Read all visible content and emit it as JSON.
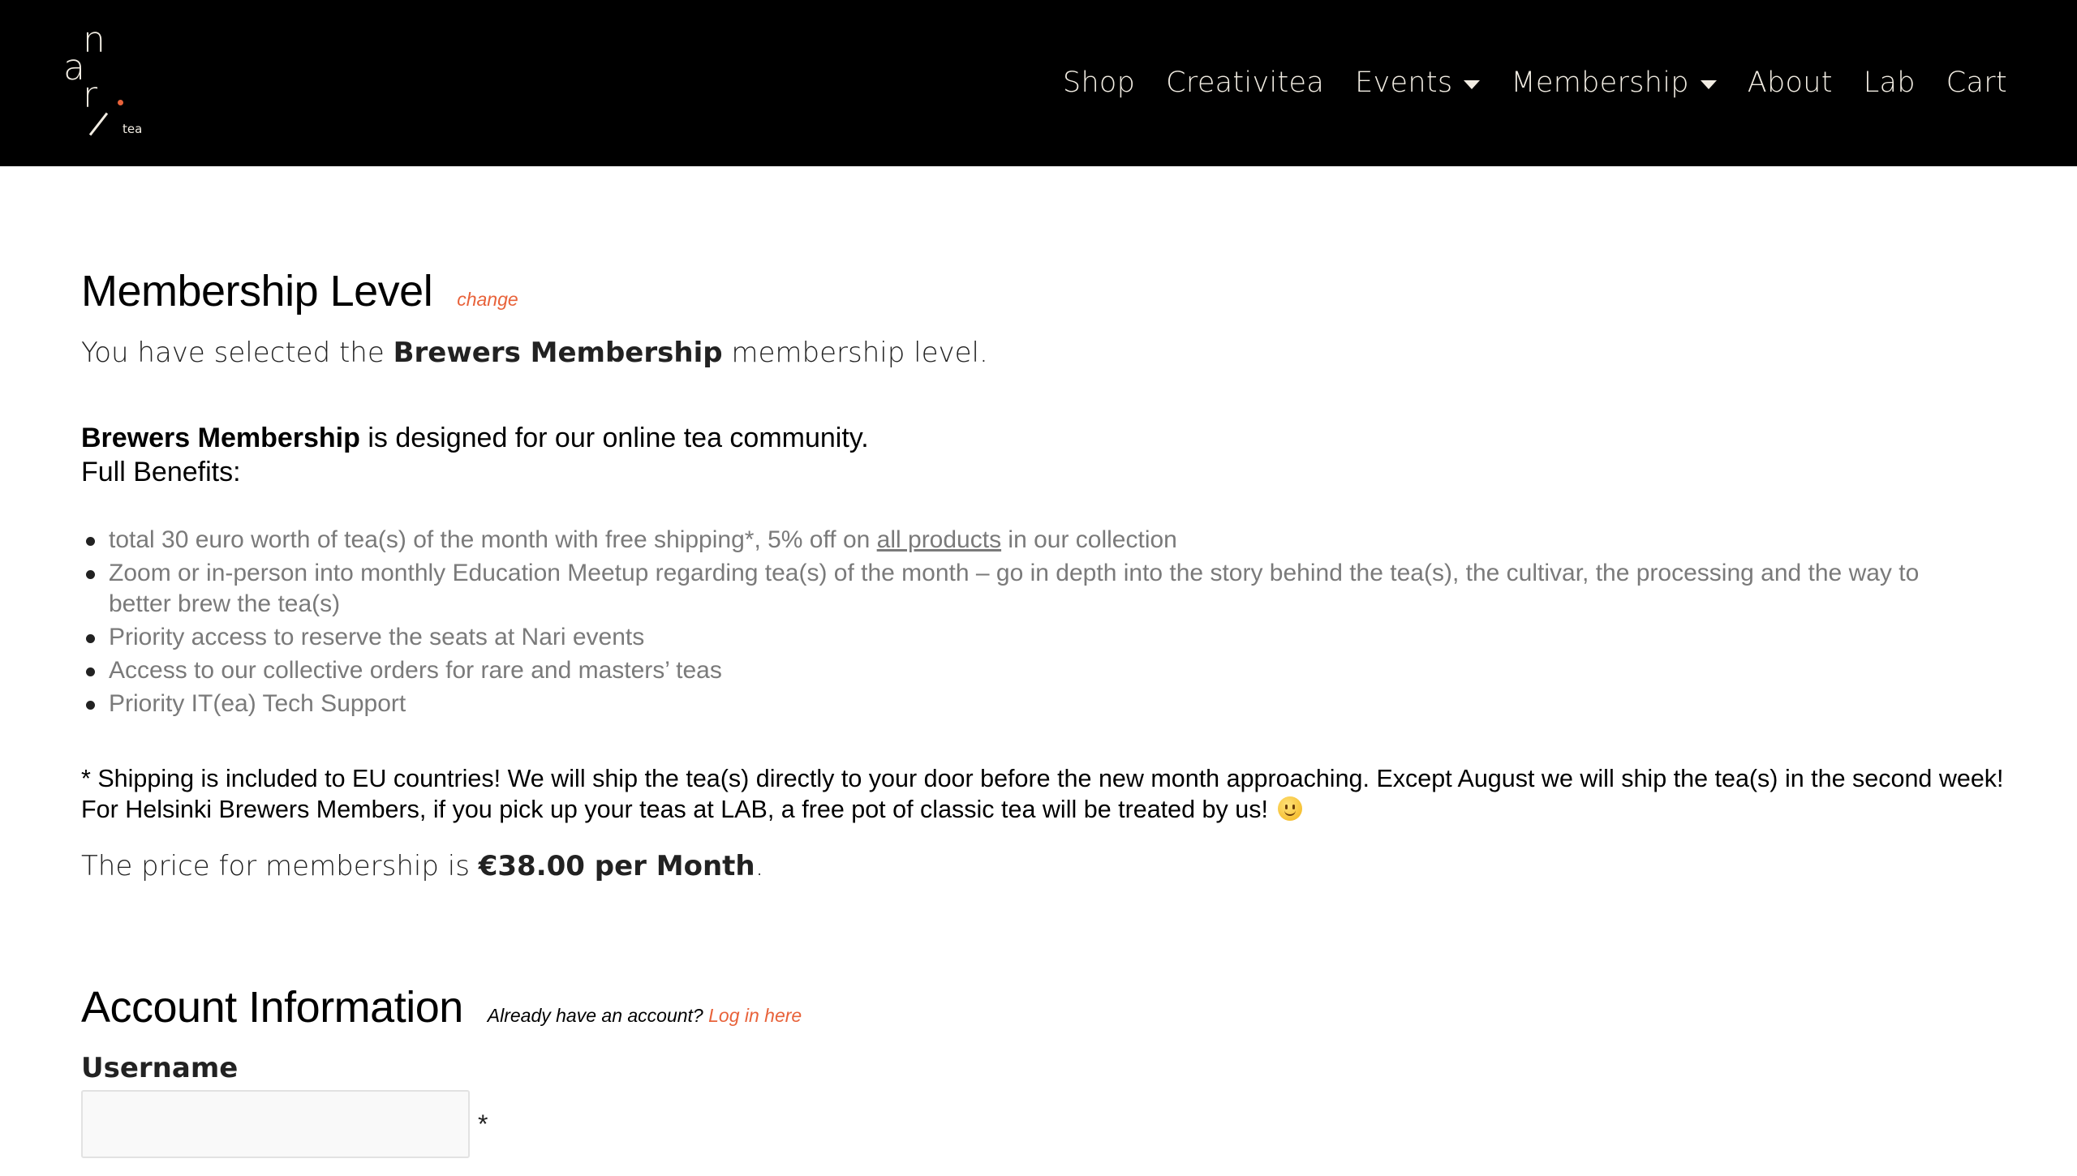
{
  "header": {
    "logo": {
      "letters": [
        "n",
        "a",
        "r"
      ],
      "suffix": "tea",
      "accent_color": "#e8623a"
    },
    "nav": [
      {
        "label": "Shop",
        "has_dropdown": false
      },
      {
        "label": "Creativitea",
        "has_dropdown": false
      },
      {
        "label": "Events",
        "has_dropdown": true
      },
      {
        "label": "Membership",
        "has_dropdown": true
      },
      {
        "label": "About",
        "has_dropdown": false
      },
      {
        "label": "Lab",
        "has_dropdown": false
      },
      {
        "label": "Cart",
        "has_dropdown": false
      }
    ]
  },
  "membership_level": {
    "title": "Membership Level",
    "change_label": "change",
    "selected_prefix": "You have selected the",
    "selected_level": "Brewers Membership",
    "selected_suffix": "membership level.",
    "description_bold": "Brewers Membership",
    "description_rest": " is designed for our online tea community.",
    "benefits_label": "Full Benefits:",
    "benefits": [
      {
        "before": "total 30 euro worth of tea(s) of the month with free shipping*, 5% off on ",
        "link": "all products",
        "after": " in our collection"
      },
      {
        "before": "Zoom or in-person into monthly Education Meetup regarding tea(s) of the month – go in depth into the story behind the tea(s), the cultivar, the processing and the way to better brew the tea(s)",
        "link": "",
        "after": ""
      },
      {
        "before": "Priority access to reserve the seats at Nari events",
        "link": "",
        "after": ""
      },
      {
        "before": "Access to our collective orders for rare and masters’ teas",
        "link": "",
        "after": ""
      },
      {
        "before": "Priority IT(ea) Tech Support",
        "link": "",
        "after": ""
      }
    ],
    "shipping_note": "* Shipping is included to EU countries! We will ship the tea(s) directly to your door before the new month approaching. Except August we will ship the tea(s) in the second week! For Helsinki Brewers Members, if you pick up your teas at LAB, a free pot of classic tea will be treated by us!",
    "shipping_note_icon": "smiley-emoji-icon",
    "price_prefix": "The price for membership is",
    "price_value": "€38.00 per Month",
    "price_suffix": "."
  },
  "account_information": {
    "title": "Account Information",
    "already_text": "Already have an account?",
    "login_label": "Log in here",
    "username_label": "Username",
    "username_value": "",
    "username_placeholder": "",
    "required_mark": "*"
  },
  "colors": {
    "header_bg": "#000000",
    "nav_text": "#f2ede3",
    "accent": "#e8623a",
    "benefit_text": "#7a7a7a"
  }
}
